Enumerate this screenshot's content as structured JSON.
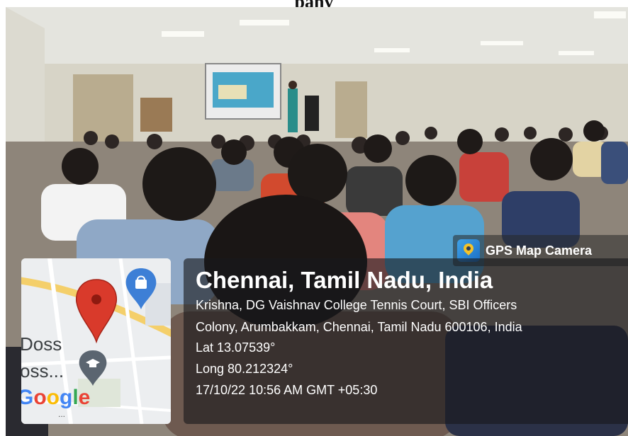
{
  "header": {
    "text": "pany"
  },
  "badge": {
    "icon": "map-pin-icon",
    "label": "GPS Map Camera"
  },
  "map": {
    "labels": {
      "place1": "Doss",
      "place2": "oss...",
      "google": "Google"
    },
    "icons": [
      "location-pin-icon",
      "shopping-bag-icon",
      "graduation-cap-icon"
    ]
  },
  "location": {
    "title": "Chennai, Tamil Nadu, India",
    "address_line1": "Krishna, DG Vaishnav College Tennis Court, SBI Officers",
    "address_line2": "Colony, Arumbakkam, Chennai, Tamil Nadu 600106, India",
    "lat": "Lat 13.07539°",
    "long": "Long 80.212324°",
    "timestamp": "17/10/22 10:56 AM GMT +05:30"
  },
  "colors": {
    "pin_red": "#d93a2b",
    "bag_blue": "#3d7fd6",
    "panel": "#19191c"
  }
}
